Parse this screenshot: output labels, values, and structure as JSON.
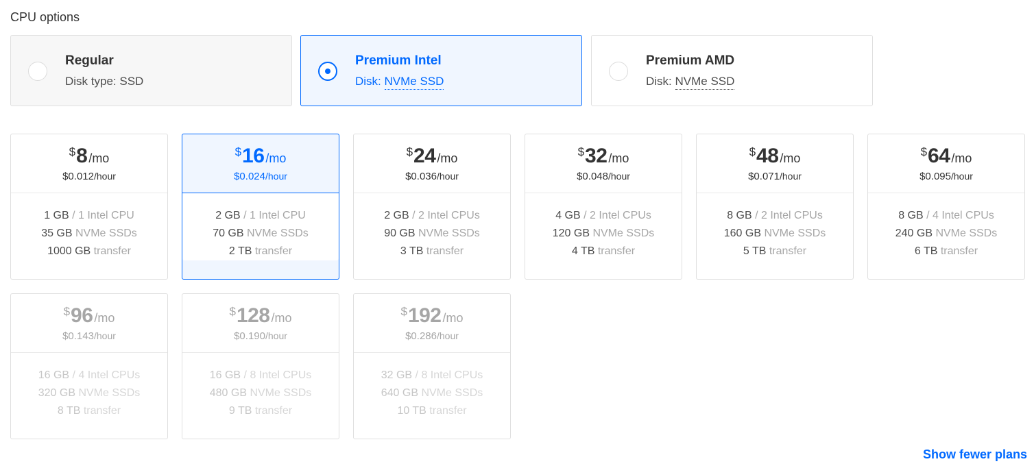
{
  "section_title": "CPU options",
  "cpu_options": [
    {
      "title": "Regular",
      "sub_label": "Disk type:",
      "sub_value": "SSD",
      "dotted": false
    },
    {
      "title": "Premium Intel",
      "sub_label": "Disk:",
      "sub_value": "NVMe SSD",
      "dotted": true,
      "selected": true
    },
    {
      "title": "Premium AMD",
      "sub_label": "Disk:",
      "sub_value": "NVMe SSD",
      "dotted": true
    }
  ],
  "plans": [
    {
      "currency": "$",
      "amount": "8",
      "period": "/mo",
      "hourly": "$0.012",
      "hour_unit": "/hour",
      "ram": "1 GB",
      "cpu": "/ 1 Intel CPU",
      "disk": "35 GB",
      "disk_type": "NVMe SSDs",
      "transfer": "1000 GB",
      "transfer_label": "transfer"
    },
    {
      "currency": "$",
      "amount": "16",
      "period": "/mo",
      "hourly": "$0.024",
      "hour_unit": "/hour",
      "ram": "2 GB",
      "cpu": "/ 1 Intel CPU",
      "disk": "70 GB",
      "disk_type": "NVMe SSDs",
      "transfer": "2 TB",
      "transfer_label": "transfer"
    },
    {
      "currency": "$",
      "amount": "24",
      "period": "/mo",
      "hourly": "$0.036",
      "hour_unit": "/hour",
      "ram": "2 GB",
      "cpu": "/ 2 Intel CPUs",
      "disk": "90 GB",
      "disk_type": "NVMe SSDs",
      "transfer": "3 TB",
      "transfer_label": "transfer"
    },
    {
      "currency": "$",
      "amount": "32",
      "period": "/mo",
      "hourly": "$0.048",
      "hour_unit": "/hour",
      "ram": "4 GB",
      "cpu": "/ 2 Intel CPUs",
      "disk": "120 GB",
      "disk_type": "NVMe SSDs",
      "transfer": "4 TB",
      "transfer_label": "transfer"
    },
    {
      "currency": "$",
      "amount": "48",
      "period": "/mo",
      "hourly": "$0.071",
      "hour_unit": "/hour",
      "ram": "8 GB",
      "cpu": "/ 2 Intel CPUs",
      "disk": "160 GB",
      "disk_type": "NVMe SSDs",
      "transfer": "5 TB",
      "transfer_label": "transfer"
    },
    {
      "currency": "$",
      "amount": "64",
      "period": "/mo",
      "hourly": "$0.095",
      "hour_unit": "/hour",
      "ram": "8 GB",
      "cpu": "/ 4 Intel CPUs",
      "disk": "240 GB",
      "disk_type": "NVMe SSDs",
      "transfer": "6 TB",
      "transfer_label": "transfer"
    },
    {
      "currency": "$",
      "amount": "96",
      "period": "/mo",
      "hourly": "$0.143",
      "hour_unit": "/hour",
      "ram": "16 GB",
      "cpu": "/ 4 Intel CPUs",
      "disk": "320 GB",
      "disk_type": "NVMe SSDs",
      "transfer": "8 TB",
      "transfer_label": "transfer"
    },
    {
      "currency": "$",
      "amount": "128",
      "period": "/mo",
      "hourly": "$0.190",
      "hour_unit": "/hour",
      "ram": "16 GB",
      "cpu": "/ 8 Intel CPUs",
      "disk": "480 GB",
      "disk_type": "NVMe SSDs",
      "transfer": "9 TB",
      "transfer_label": "transfer"
    },
    {
      "currency": "$",
      "amount": "192",
      "period": "/mo",
      "hourly": "$0.286",
      "hour_unit": "/hour",
      "ram": "32 GB",
      "cpu": "/ 8 Intel CPUs",
      "disk": "640 GB",
      "disk_type": "NVMe SSDs",
      "transfer": "10 TB",
      "transfer_label": "transfer"
    }
  ],
  "show_fewer_label": "Show fewer plans",
  "colors": {
    "accent": "#0069ff",
    "selected_bg": "#f0f6ff",
    "border": "#dfdfdf"
  }
}
